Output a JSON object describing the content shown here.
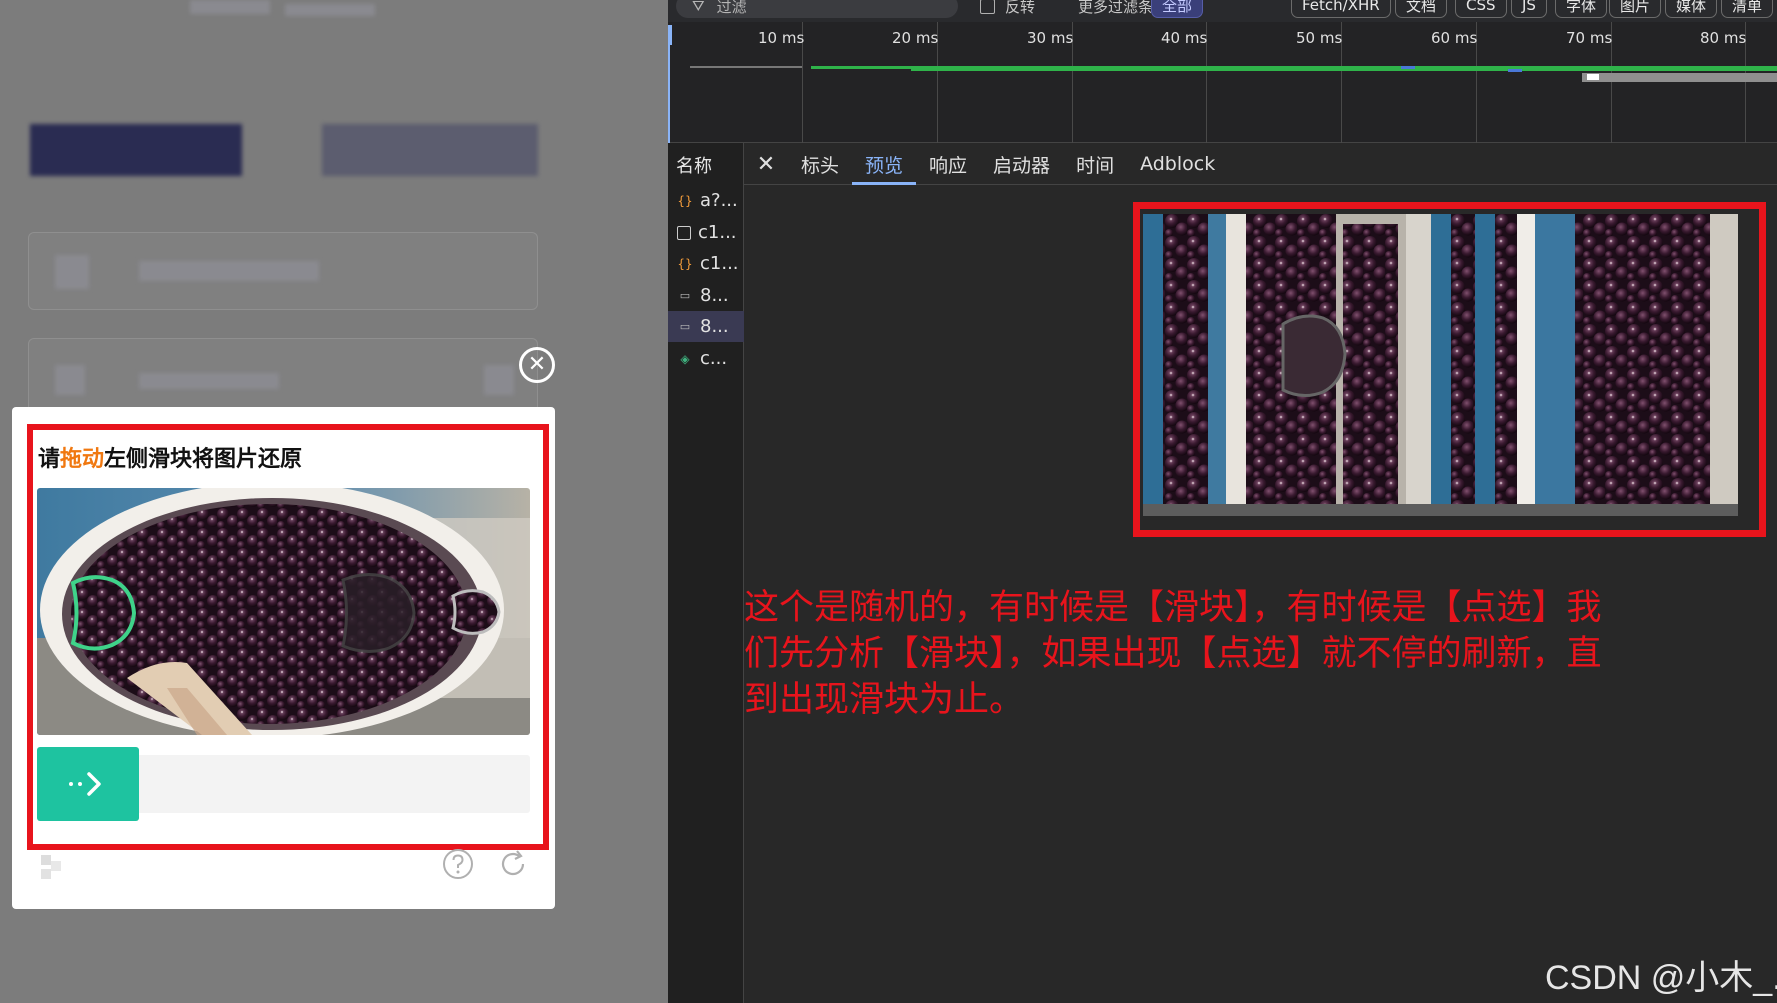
{
  "captcha": {
    "title_prefix": "请",
    "title_highlight": "拖动",
    "title_suffix": "左侧滑块将图片还原"
  },
  "devtools": {
    "toolbar": {
      "filter_placeholder": "过滤",
      "invert_label": "反转",
      "more_filters_label": "更多过滤条件 ▼",
      "type_buttons": [
        "全部",
        "Fetch/XHR",
        "文档",
        "CSS",
        "JS",
        "字体",
        "图片",
        "媒体",
        "清单"
      ]
    },
    "timeline_labels": [
      "10 ms",
      "20 ms",
      "30 ms",
      "40 ms",
      "50 ms",
      "60 ms",
      "70 ms",
      "80 ms"
    ],
    "name_header": "名称",
    "requests": [
      {
        "name": "a?...",
        "type": "json"
      },
      {
        "name": "c1...",
        "type": "doc"
      },
      {
        "name": "c1...",
        "type": "json"
      },
      {
        "name": "8...",
        "type": "img"
      },
      {
        "name": "8...",
        "type": "img",
        "selected": true
      },
      {
        "name": "c...",
        "type": "font"
      }
    ],
    "tabs": [
      "标头",
      "预览",
      "响应",
      "启动器",
      "时间",
      "Adblock"
    ],
    "active_tab": "预览"
  },
  "annotation": "这个是随机的，有时候是【滑块】，有时候是【点选】我们先分析【滑块】，如果出现【点选】就不停的刷新，直到出现滑块为止。",
  "watermark": "CSDN @小木_.",
  "colors": {
    "highlight_red": "#e8141c",
    "slider_green": "#1ec3a0",
    "title_orange": "#f07810",
    "active_tab_blue": "#8ab4f8"
  }
}
